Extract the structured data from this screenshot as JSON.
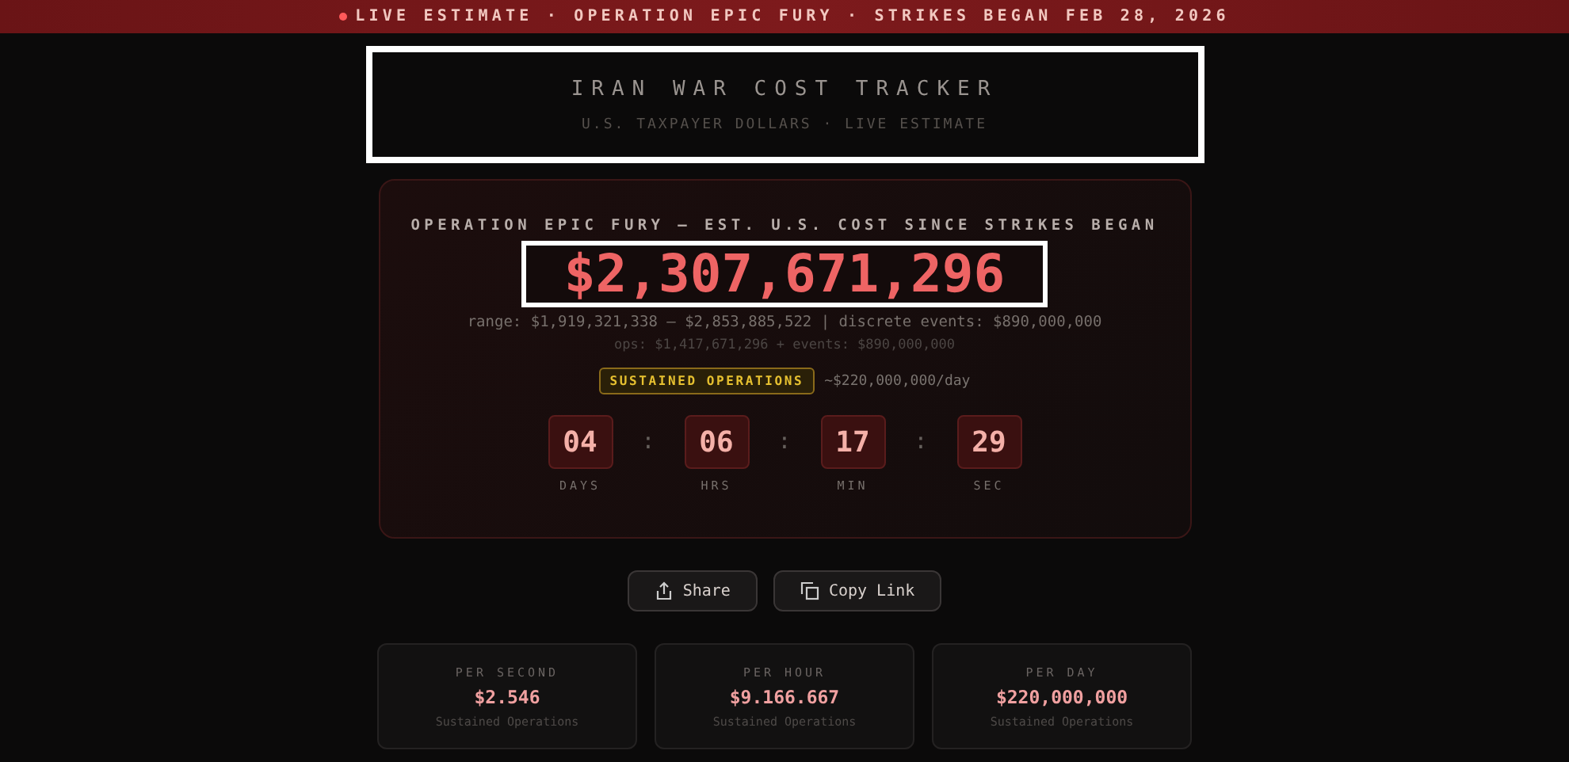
{
  "banner": {
    "live": true,
    "text": "LIVE ESTIMATE · OPERATION EPIC FURY · STRIKES BEGAN FEB 28, 2026"
  },
  "header": {
    "title": "IRAN WAR COST TRACKER",
    "subtitle": "U.S. TAXPAYER DOLLARS · LIVE ESTIMATE"
  },
  "counter": {
    "label": "OPERATION EPIC FURY — EST. U.S. COST SINCE STRIKES BEGAN",
    "total": "$2,307,671,296",
    "range": "range: $1,919,321,338 – $2,853,885,522 | discrete events: $890,000,000",
    "breakdown": "ops: $1,417,671,296 + events: $890,000,000",
    "phase": "SUSTAINED OPERATIONS",
    "rate": "~$220,000,000/day",
    "clock": [
      {
        "value": "04",
        "unit": "DAYS"
      },
      {
        "value": "06",
        "unit": "HRS"
      },
      {
        "value": "17",
        "unit": "MIN"
      },
      {
        "value": "29",
        "unit": "SEC"
      }
    ],
    "separator": ":"
  },
  "buttons": [
    {
      "kind": "share",
      "label": "Share"
    },
    {
      "kind": "copy",
      "label": "Copy Link"
    }
  ],
  "stats": [
    {
      "label": "PER SECOND",
      "value": "$2.546",
      "note": "Sustained Operations"
    },
    {
      "label": "PER HOUR",
      "value": "$9.166.667",
      "note": "Sustained Operations"
    },
    {
      "label": "PER DAY",
      "value": "$220,000,000",
      "note": "Sustained Operations"
    }
  ]
}
